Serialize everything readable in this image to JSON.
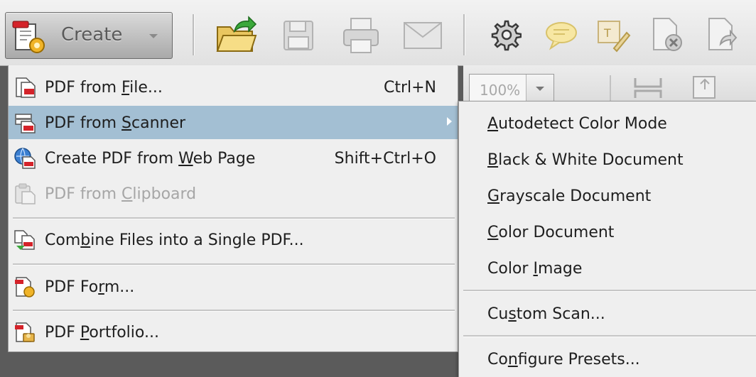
{
  "toolbar": {
    "create_label": "Create",
    "icons": [
      "open-folder-icon",
      "save-icon",
      "print-icon",
      "email-icon",
      "gear-icon",
      "comment-icon",
      "sign-icon",
      "delete-file-icon",
      "share-file-icon"
    ]
  },
  "zoom": {
    "value": "100%"
  },
  "menu": {
    "items": [
      {
        "pre": "PDF from ",
        "u": "F",
        "post": "ile...",
        "shortcut": "Ctrl+N",
        "icon": "pdf-from-file-icon"
      },
      {
        "pre": "PDF from ",
        "u": "S",
        "post": "canner",
        "shortcut": "",
        "icon": "scanner-icon"
      },
      {
        "pre": "Create PDF from ",
        "u": "W",
        "post": "eb Page",
        "shortcut": "Shift+Ctrl+O",
        "icon": "web-page-icon"
      },
      {
        "pre": "PDF from ",
        "u": "C",
        "post": "lipboard",
        "shortcut": "",
        "icon": "clipboard-icon"
      },
      {
        "pre": "Com",
        "u": "b",
        "post": "ine Files into a Single PDF...",
        "shortcut": "",
        "icon": "combine-files-icon"
      },
      {
        "pre": "PDF Fo",
        "u": "r",
        "post": "m...",
        "shortcut": "",
        "icon": "pdf-form-icon"
      },
      {
        "pre": "PDF ",
        "u": "P",
        "post": "ortfolio...",
        "shortcut": "",
        "icon": "pdf-portfolio-icon"
      }
    ]
  },
  "submenu": {
    "items": [
      {
        "pre": "",
        "u": "A",
        "post": "utodetect Color Mode"
      },
      {
        "pre": "",
        "u": "B",
        "post": "lack & White Document"
      },
      {
        "pre": "",
        "u": "G",
        "post": "rayscale Document"
      },
      {
        "pre": "",
        "u": "C",
        "post": "olor Document"
      },
      {
        "pre": "Color ",
        "u": "I",
        "post": "mage"
      },
      {
        "pre": "Cu",
        "u": "s",
        "post": "tom Scan..."
      },
      {
        "pre": "Co",
        "u": "n",
        "post": "figure Presets..."
      }
    ]
  },
  "colors": {
    "highlight": "#a3bfd3",
    "menu_bg": "#efefef",
    "disabled_text": "#a6a6a6"
  }
}
